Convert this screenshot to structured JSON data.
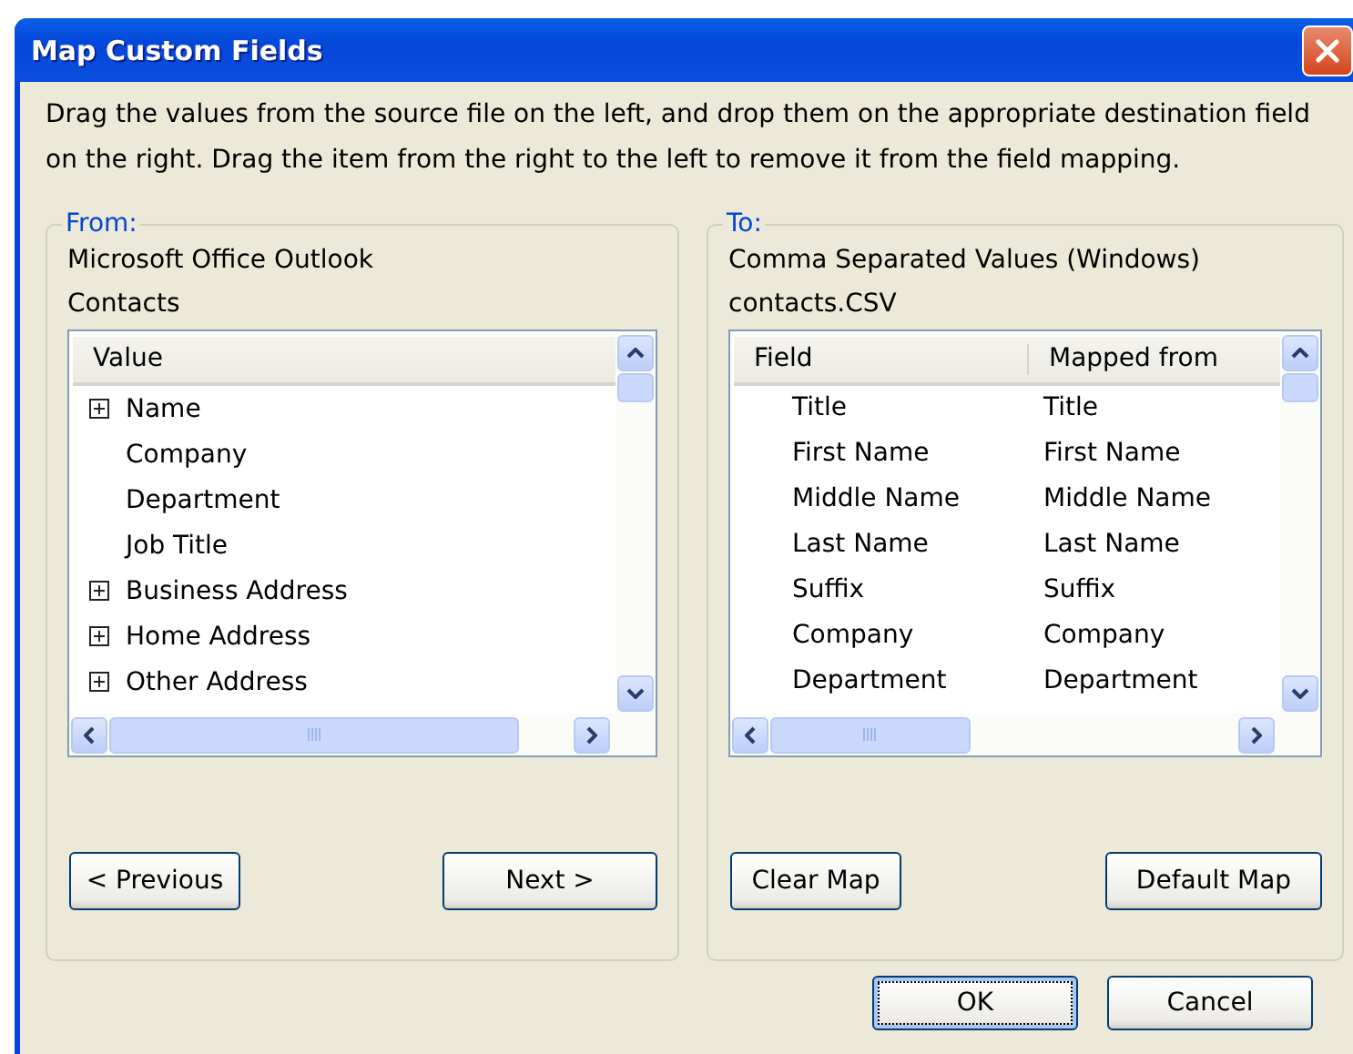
{
  "window": {
    "title": "Map Custom Fields"
  },
  "instructions": "Drag the values from the source file on the left, and drop them on the appropriate destination field\non the right.  Drag the item from the right to the left to remove it from the field mapping.",
  "from": {
    "label": "From:",
    "source_lines": [
      "Microsoft Office Outlook",
      "Contacts"
    ],
    "list": {
      "columns": [
        "Value"
      ],
      "items": [
        {
          "label": "Name",
          "kind": "group",
          "expanded": false
        },
        {
          "label": "Company",
          "kind": "field"
        },
        {
          "label": "Department",
          "kind": "field"
        },
        {
          "label": "Job Title",
          "kind": "field"
        },
        {
          "label": "Business Address",
          "kind": "group",
          "expanded": false
        },
        {
          "label": "Home Address",
          "kind": "group",
          "expanded": false
        },
        {
          "label": "Other Address",
          "kind": "group",
          "expanded": false
        }
      ]
    },
    "buttons": [
      {
        "label": "< Previous",
        "focused": false
      },
      {
        "label": "Next >",
        "focused": false
      }
    ]
  },
  "to": {
    "label": "To:",
    "source_lines": [
      "Comma Separated Values (Windows)",
      "contacts.CSV"
    ],
    "table": {
      "columns": [
        "Field",
        "Mapped from"
      ],
      "rows": [
        [
          "Title",
          "Title"
        ],
        [
          "First Name",
          "First Name"
        ],
        [
          "Middle Name",
          "Middle Name"
        ],
        [
          "Last Name",
          "Last Name"
        ],
        [
          "Suffix",
          "Suffix"
        ],
        [
          "Company",
          "Company"
        ],
        [
          "Department",
          "Department"
        ]
      ]
    },
    "buttons": [
      {
        "label": "Clear Map",
        "focused": false
      },
      {
        "label": "Default Map",
        "focused": false
      }
    ]
  },
  "buttons": [
    {
      "label": "OK",
      "focused": true
    },
    {
      "label": "Cancel",
      "focused": false
    }
  ]
}
